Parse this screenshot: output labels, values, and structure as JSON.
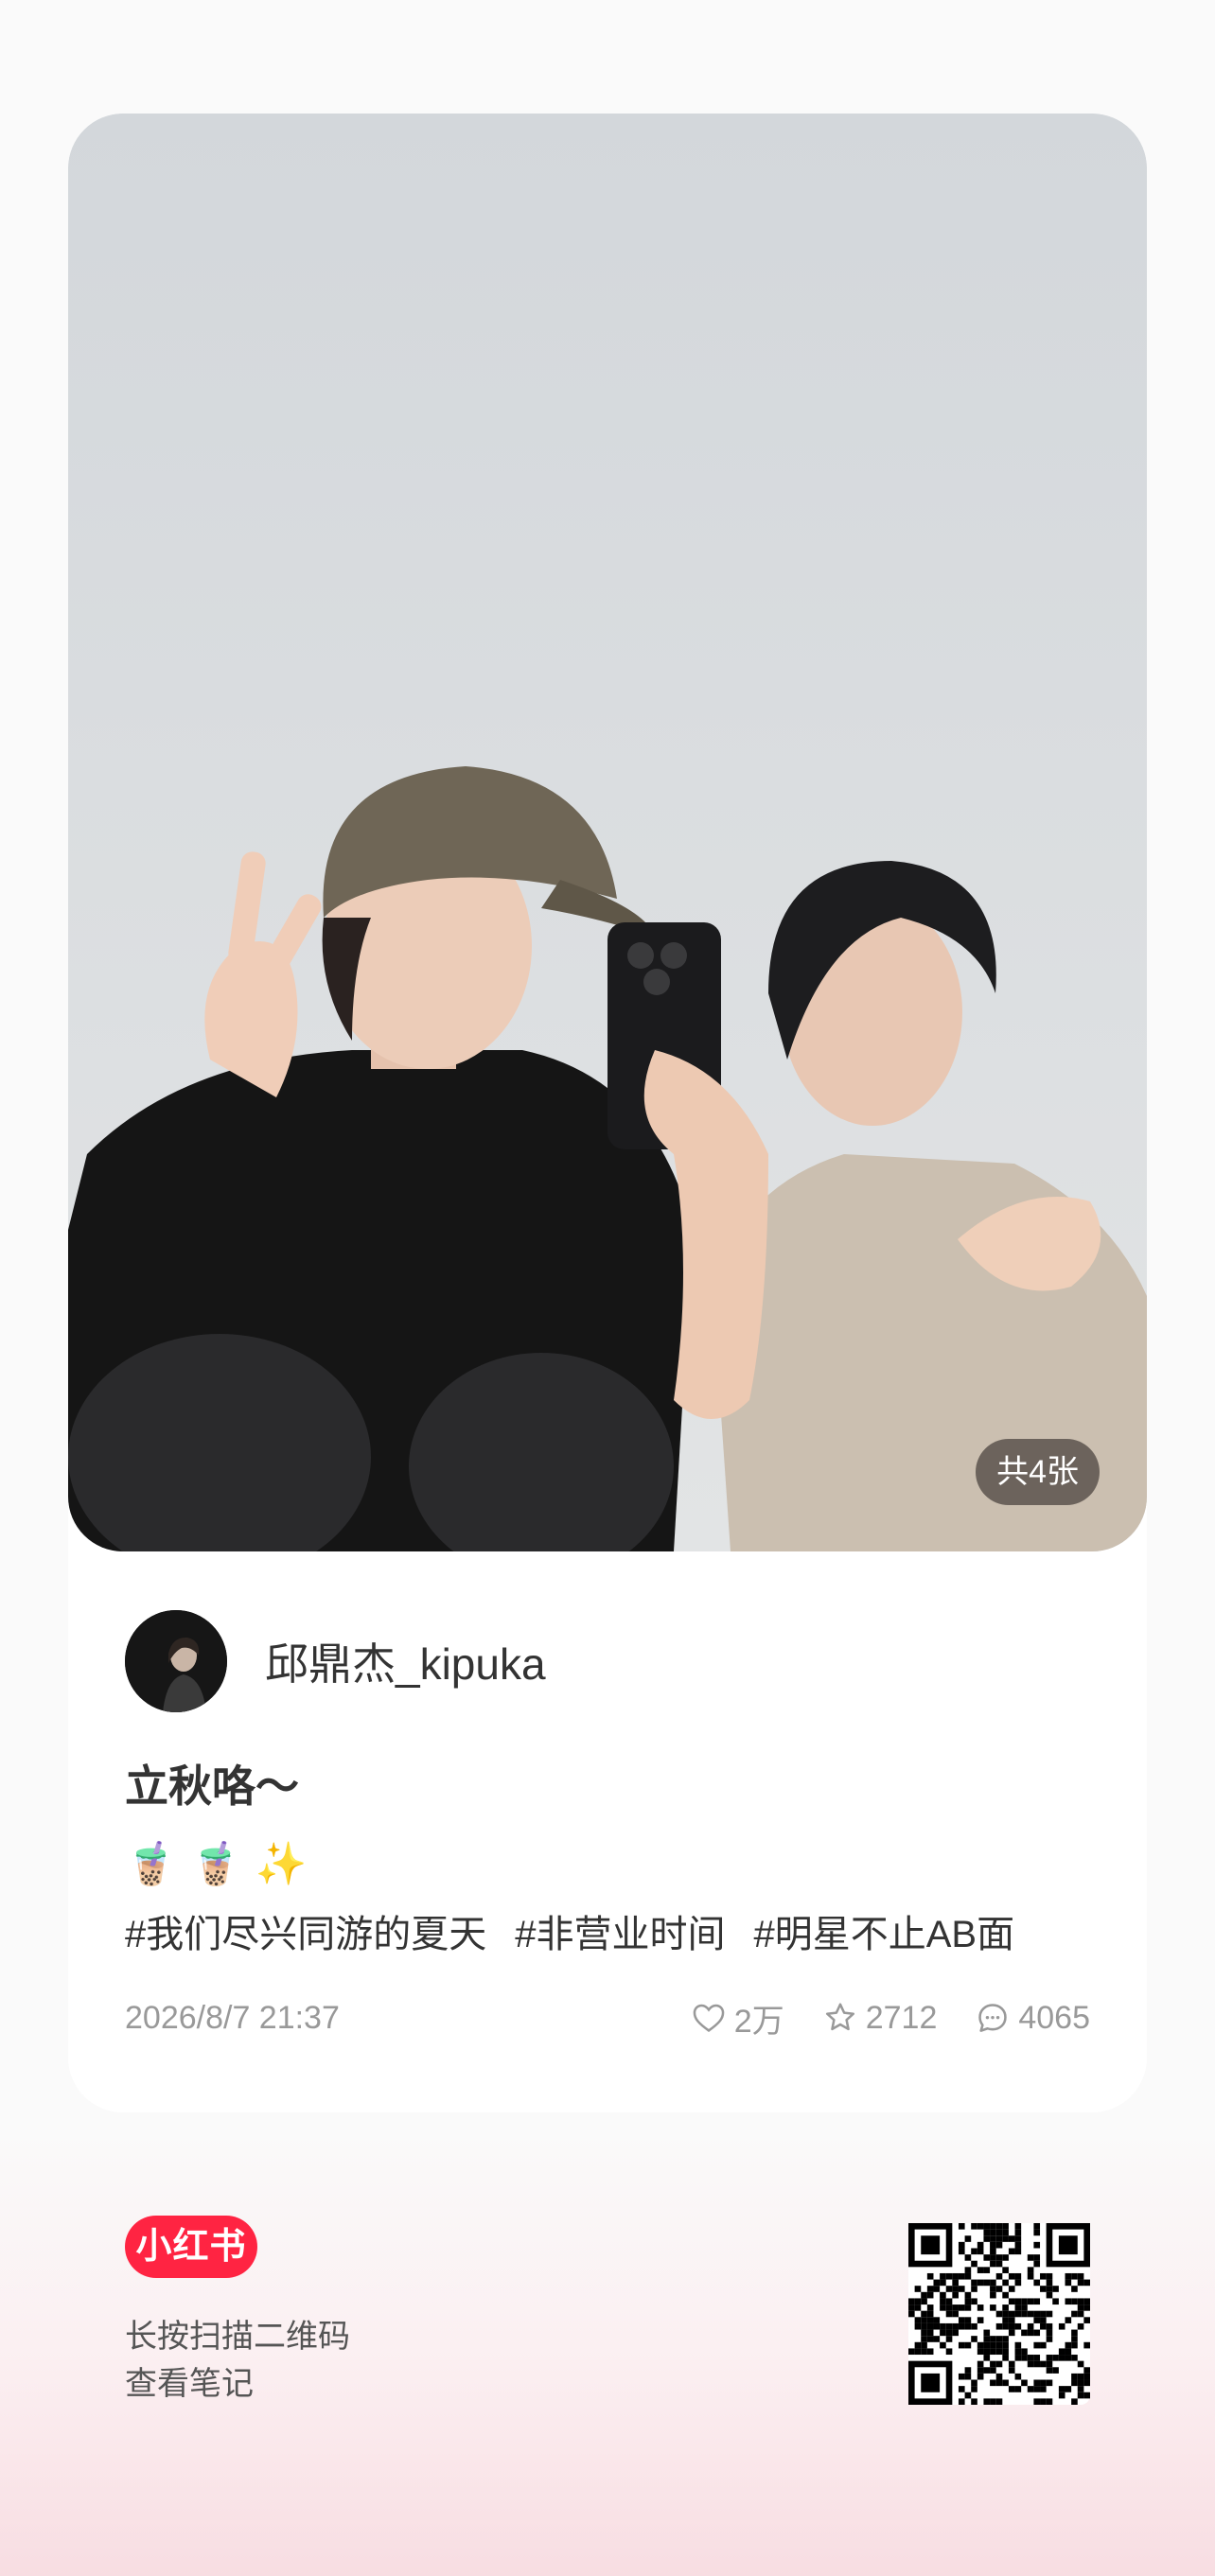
{
  "post": {
    "image_count_label": "共4张",
    "author_name": "邱鼎杰_kipuka",
    "title": "立秋咯～",
    "emojis": [
      "🧋",
      "🧋",
      "✨"
    ],
    "tags": [
      "#我们尽兴同游的夏天",
      "#非营业时间",
      "#明星不止AB面"
    ],
    "date": "2026/8/7  21:37",
    "likes": "2万",
    "collects": "2712",
    "comments": "4065"
  },
  "footer": {
    "brand": "小红书",
    "hint_line1": "长按扫描二维码",
    "hint_line2": "查看笔记"
  },
  "colors": {
    "brand_red": "#ff2442",
    "photo_wall": "#d7dbdf"
  },
  "icons": {
    "like": "heart-icon",
    "collect": "star-icon",
    "comment": "comment-icon"
  }
}
